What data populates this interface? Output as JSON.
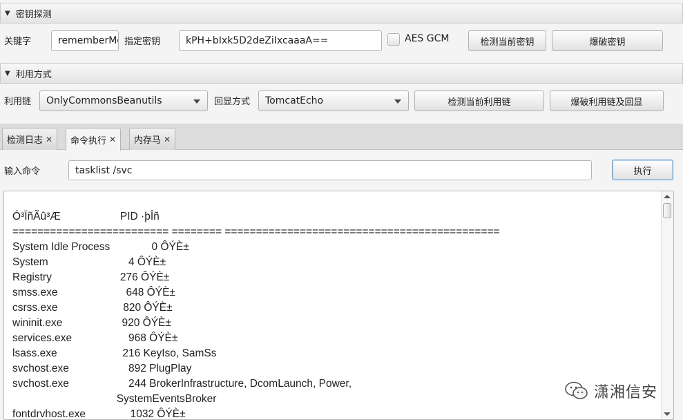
{
  "key_section": {
    "title": "密钥探测",
    "keyword_label": "关键字",
    "keyword_value": "rememberMe",
    "specify_key_label": "指定密钥",
    "key_value": "kPH+bIxk5D2deZiIxcaaaA==",
    "aes_gcm_label": "AES GCM",
    "aes_gcm_checked": false,
    "detect_key_button": "检测当前密钥",
    "brute_key_button": "爆破密钥"
  },
  "exploit_section": {
    "title": "利用方式",
    "chain_label": "利用链",
    "chain_value": "OnlyCommonsBeanutils",
    "echo_label": "回显方式",
    "echo_value": "TomcatEcho",
    "detect_chain_button": "检测当前利用链",
    "brute_chain_button": "爆破利用链及回显"
  },
  "tabs": [
    {
      "label": "检测日志",
      "close": "✕",
      "selected": false
    },
    {
      "label": "命令执行",
      "close": "✕",
      "selected": true
    },
    {
      "label": "内存马",
      "close": "✕",
      "selected": false
    }
  ],
  "command": {
    "label": "输入命令",
    "value": "tasklist /svc",
    "execute_button": "执行"
  },
  "output": {
    "lines": [
      "Ó³ÏñÃû³Æ                    PID ·þÎñ",
      "========================= ======== ============================================",
      "System Idle Process              0 ÔÝÈ±",
      "System                           4 ÔÝÈ±",
      "Registry                       276 ÔÝÈ±",
      "smss.exe                       648 ÔÝÈ±",
      "csrss.exe                      820 ÔÝÈ±",
      "wininit.exe                    920 ÔÝÈ±",
      "services.exe                   968 ÔÝÈ±",
      "lsass.exe                      216 KeyIso, SamSs",
      "svchost.exe                    892 PlugPlay",
      "svchost.exe                    244 BrokerInfrastructure, DcomLaunch, Power,",
      "                                   SystemEventsBroker",
      "fontdrvhost.exe               1032 ÔÝÈ±"
    ]
  },
  "watermark": {
    "text": "潇湘信安",
    "icon": "wechat-icon"
  }
}
